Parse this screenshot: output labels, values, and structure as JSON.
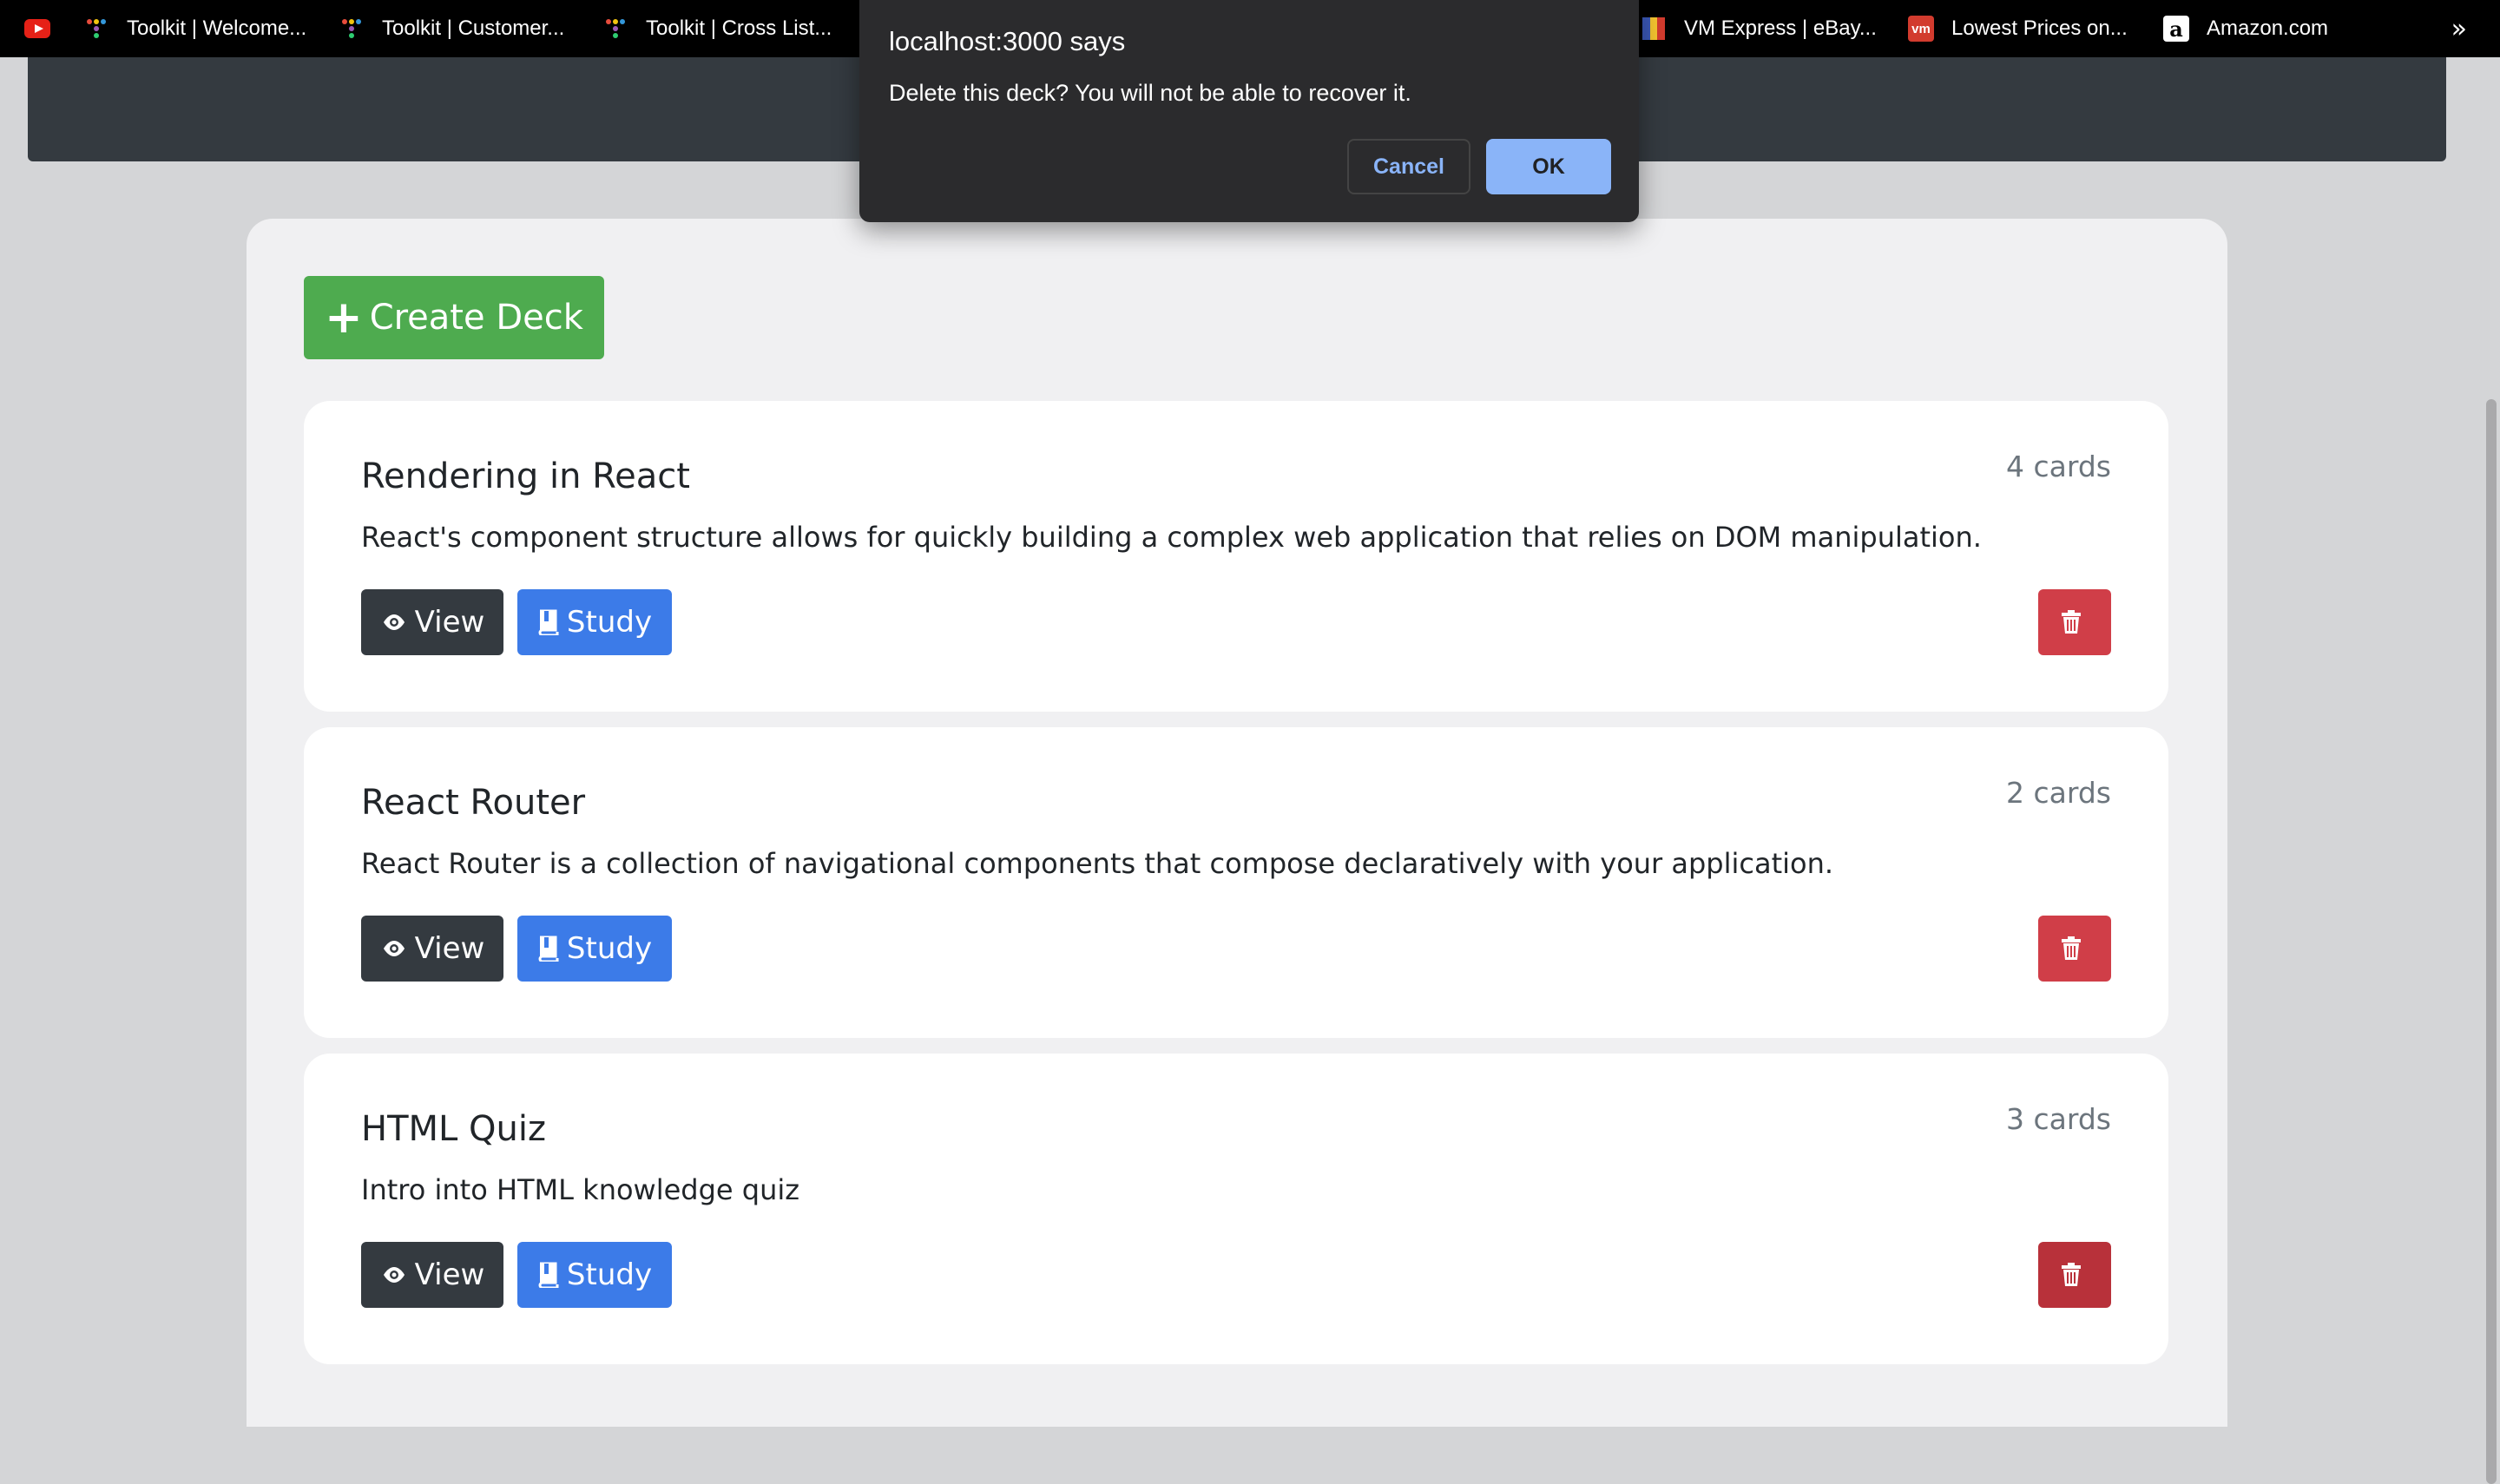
{
  "bookmarks": [
    {
      "label": "",
      "icon": "youtube-icon"
    },
    {
      "label": "Toolkit | Welcome...",
      "icon": "toolkit-icon"
    },
    {
      "label": "Toolkit | Customer...",
      "icon": "toolkit-icon"
    },
    {
      "label": "Toolkit | Cross List...",
      "icon": "toolkit-icon"
    },
    {
      "label": "VM Express | eBay...",
      "icon": "flag-icon"
    },
    {
      "label": "Lowest Prices on...",
      "icon": "vm-icon"
    },
    {
      "label": "Amazon.com",
      "icon": "amazon-icon"
    }
  ],
  "bookmarks_overflow": "»",
  "dialog": {
    "title": "localhost:3000 says",
    "message": "Delete this deck? You will not be able to recover it.",
    "cancel_label": "Cancel",
    "ok_label": "OK"
  },
  "create_button": {
    "icon": "+",
    "label": "Create Deck"
  },
  "decks": [
    {
      "title": "Rendering in React",
      "count": "4 cards",
      "description": "React's component structure allows for quickly building a complex web application that relies on DOM manipulation.",
      "view_label": "View",
      "study_label": "Study"
    },
    {
      "title": "React Router",
      "count": "2 cards",
      "description": "React Router is a collection of navigational components that compose declaratively with your application.",
      "view_label": "View",
      "study_label": "Study"
    },
    {
      "title": "HTML Quiz",
      "count": "3 cards",
      "description": "Intro into HTML knowledge quiz",
      "view_label": "View",
      "study_label": "Study"
    }
  ],
  "colors": {
    "create": "#4eab4f",
    "view": "#343a40",
    "study": "#3c7be8",
    "delete": "#d03e48",
    "dialog_ok": "#8ab4f8"
  }
}
